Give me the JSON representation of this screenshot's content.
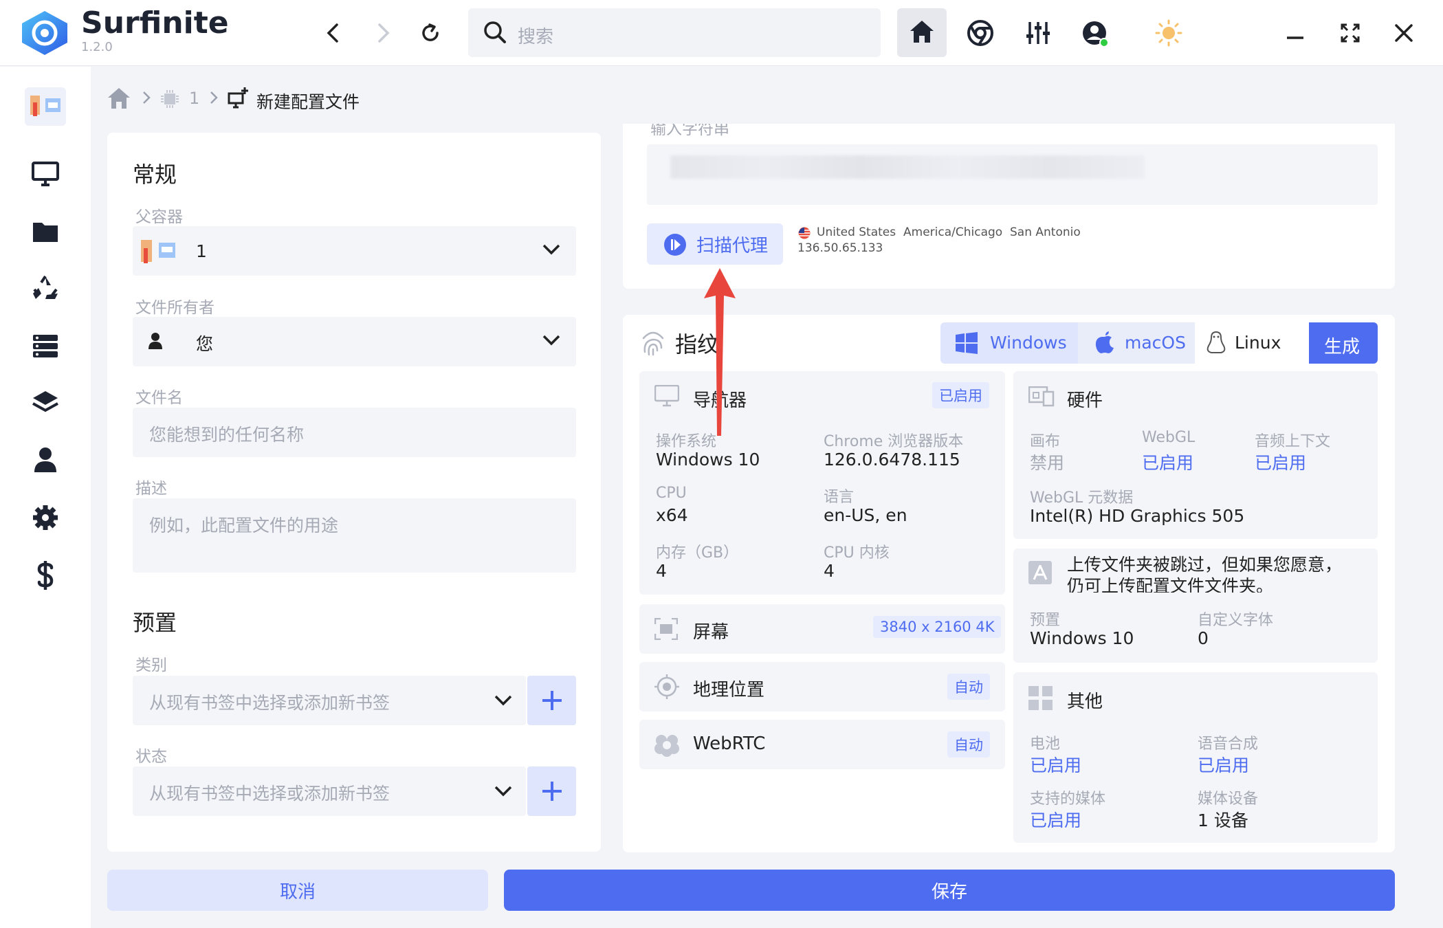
{
  "app": {
    "name": "Surfinite",
    "version": "1.2.0"
  },
  "search": {
    "placeholder": "搜索"
  },
  "breadcrumb": {
    "level1": "1",
    "current": "新建配置文件"
  },
  "general": {
    "title": "常规",
    "parent_label": "父容器",
    "parent_value": "1",
    "owner_label": "文件所有者",
    "owner_value": "您",
    "filename_label": "文件名",
    "filename_placeholder": "您能想到的任何名称",
    "desc_label": "描述",
    "desc_placeholder": "例如，此配置文件的用途"
  },
  "presets": {
    "title": "预置",
    "category_label": "类别",
    "category_placeholder": "从现有书签中选择或添加新书签",
    "status_label": "状态",
    "status_placeholder": "从现有书签中选择或添加新书签"
  },
  "proxy": {
    "input_label": "输入字符串",
    "scan_label": "扫描代理",
    "country": "United States",
    "ip": "136.50.65.133",
    "timezone": "America/Chicago",
    "city": "San Antonio"
  },
  "fingerprint": {
    "title": "指纹",
    "os_tabs": [
      "Windows",
      "macOS",
      "Linux"
    ],
    "generate_label": "生成",
    "navigator": {
      "title": "导航器",
      "badge": "已启用",
      "os_k": "操作系统",
      "os_v": "Windows 10",
      "chrome_k": "Chrome 浏览器版本",
      "chrome_v": "126.0.6478.115",
      "cpu_k": "CPU",
      "cpu_v": "x64",
      "lang_k": "语言",
      "lang_v": "en-US, en",
      "mem_k": "内存（GB）",
      "mem_v": "4",
      "cores_k": "CPU 内核",
      "cores_v": "4"
    },
    "screen": {
      "title": "屏幕",
      "badge": "3840 x 2160 4K"
    },
    "geo": {
      "title": "地理位置",
      "badge": "自动"
    },
    "webrtc": {
      "title": "WebRTC",
      "badge": "自动"
    },
    "hardware": {
      "title": "硬件",
      "canvas_k": "画布",
      "canvas_v": "禁用",
      "webgl_k": "WebGL",
      "webgl_v": "已启用",
      "audio_k": "音频上下文",
      "audio_v": "已启用",
      "meta_k": "WebGL 元数据",
      "meta_v": "Intel(R) HD Graphics 505"
    },
    "fonts": {
      "notice_line1": "上传文件夹被跳过，但如果您愿意，",
      "notice_line2": "仍可上传配置文件文件夹。",
      "preset_k": "预置",
      "preset_v": "Windows 10",
      "custom_k": "自定义字体",
      "custom_v": "0"
    },
    "other": {
      "title": "其他",
      "battery_k": "电池",
      "battery_v": "已启用",
      "speech_k": "语音合成",
      "speech_v": "已启用",
      "media_k": "支持的媒体",
      "media_v": "已启用",
      "devices_k": "媒体设备",
      "devices_v": "1 设备"
    }
  },
  "footer": {
    "cancel_label": "取消",
    "save_label": "保存"
  },
  "colors": {
    "accent": "#4e6cf0",
    "arrow": "#e8453c"
  }
}
